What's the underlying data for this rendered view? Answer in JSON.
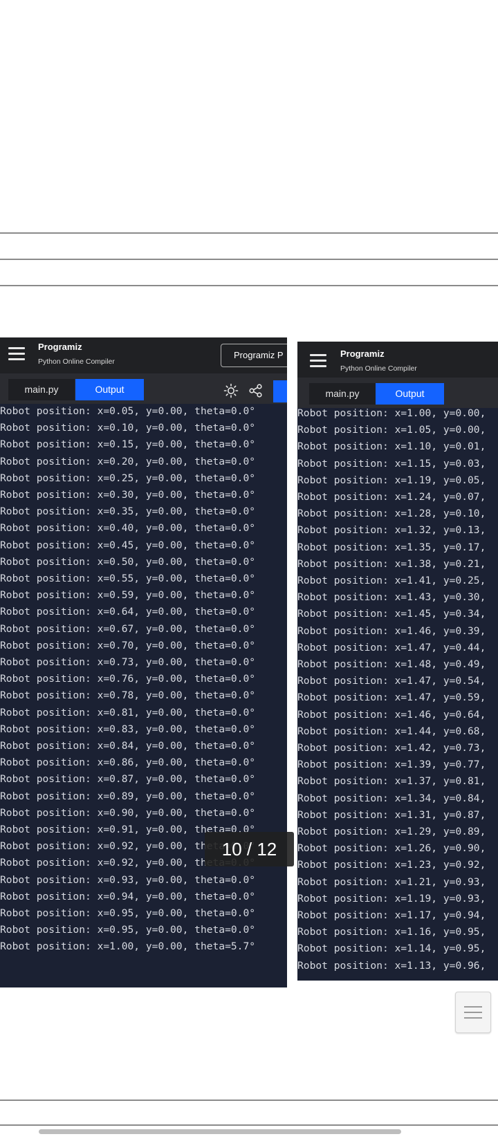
{
  "left_screenshot": {
    "brand_name": "Programiz",
    "brand_subtitle": "Python Online Compiler",
    "brand_button": "Programiz P",
    "tab_main": "main.py",
    "tab_output": "Output",
    "lines": [
      "Robot position: x=0.05, y=0.00, theta=0.0°",
      "Robot position: x=0.10, y=0.00, theta=0.0°",
      "Robot position: x=0.15, y=0.00, theta=0.0°",
      "Robot position: x=0.20, y=0.00, theta=0.0°",
      "Robot position: x=0.25, y=0.00, theta=0.0°",
      "Robot position: x=0.30, y=0.00, theta=0.0°",
      "Robot position: x=0.35, y=0.00, theta=0.0°",
      "Robot position: x=0.40, y=0.00, theta=0.0°",
      "Robot position: x=0.45, y=0.00, theta=0.0°",
      "Robot position: x=0.50, y=0.00, theta=0.0°",
      "Robot position: x=0.55, y=0.00, theta=0.0°",
      "Robot position: x=0.59, y=0.00, theta=0.0°",
      "Robot position: x=0.64, y=0.00, theta=0.0°",
      "Robot position: x=0.67, y=0.00, theta=0.0°",
      "Robot position: x=0.70, y=0.00, theta=0.0°",
      "Robot position: x=0.73, y=0.00, theta=0.0°",
      "Robot position: x=0.76, y=0.00, theta=0.0°",
      "Robot position: x=0.78, y=0.00, theta=0.0°",
      "Robot position: x=0.81, y=0.00, theta=0.0°",
      "Robot position: x=0.83, y=0.00, theta=0.0°",
      "Robot position: x=0.84, y=0.00, theta=0.0°",
      "Robot position: x=0.86, y=0.00, theta=0.0°",
      "Robot position: x=0.87, y=0.00, theta=0.0°",
      "Robot position: x=0.89, y=0.00, theta=0.0°",
      "Robot position: x=0.90, y=0.00, theta=0.0°",
      "Robot position: x=0.91, y=0.00, theta=0.0°",
      "Robot position: x=0.92, y=0.00, theta=0.0°",
      "Robot position: x=0.92, y=0.00, theta=0.0°",
      "Robot position: x=0.93, y=0.00, theta=0.0°",
      "Robot position: x=0.94, y=0.00, theta=0.0°",
      "Robot position: x=0.95, y=0.00, theta=0.0°",
      "Robot position: x=0.95, y=0.00, theta=0.0°",
      "Robot position: x=1.00, y=0.00, theta=5.7°"
    ]
  },
  "right_screenshot": {
    "brand_name": "Programiz",
    "brand_subtitle": "Python Online Compiler",
    "tab_main": "main.py",
    "tab_output": "Output",
    "lines": [
      "Robot position: x=1.00, y=0.00,",
      "Robot position: x=1.05, y=0.00,",
      "Robot position: x=1.10, y=0.01,",
      "Robot position: x=1.15, y=0.03,",
      "Robot position: x=1.19, y=0.05,",
      "Robot position: x=1.24, y=0.07,",
      "Robot position: x=1.28, y=0.10,",
      "Robot position: x=1.32, y=0.13,",
      "Robot position: x=1.35, y=0.17,",
      "Robot position: x=1.38, y=0.21,",
      "Robot position: x=1.41, y=0.25,",
      "Robot position: x=1.43, y=0.30,",
      "Robot position: x=1.45, y=0.34,",
      "Robot position: x=1.46, y=0.39,",
      "Robot position: x=1.47, y=0.44,",
      "Robot position: x=1.48, y=0.49,",
      "Robot position: x=1.47, y=0.54,",
      "Robot position: x=1.47, y=0.59,",
      "Robot position: x=1.46, y=0.64,",
      "Robot position: x=1.44, y=0.68,",
      "Robot position: x=1.42, y=0.73,",
      "Robot position: x=1.39, y=0.77,",
      "Robot position: x=1.37, y=0.81,",
      "Robot position: x=1.34, y=0.84,",
      "Robot position: x=1.31, y=0.87,",
      "Robot position: x=1.29, y=0.89,",
      "Robot position: x=1.26, y=0.90,",
      "Robot position: x=1.23, y=0.92,",
      "Robot position: x=1.21, y=0.93,",
      "Robot position: x=1.19, y=0.93,",
      "Robot position: x=1.17, y=0.94,",
      "Robot position: x=1.16, y=0.95,",
      "Robot position: x=1.14, y=0.95,",
      "Robot position: x=1.13, y=0.96,"
    ]
  },
  "viewer": {
    "counter": "10 / 12"
  },
  "colors": {
    "console_bg": "#1b2133",
    "topbar_bg": "#202124",
    "accent_blue": "#1463ff"
  }
}
